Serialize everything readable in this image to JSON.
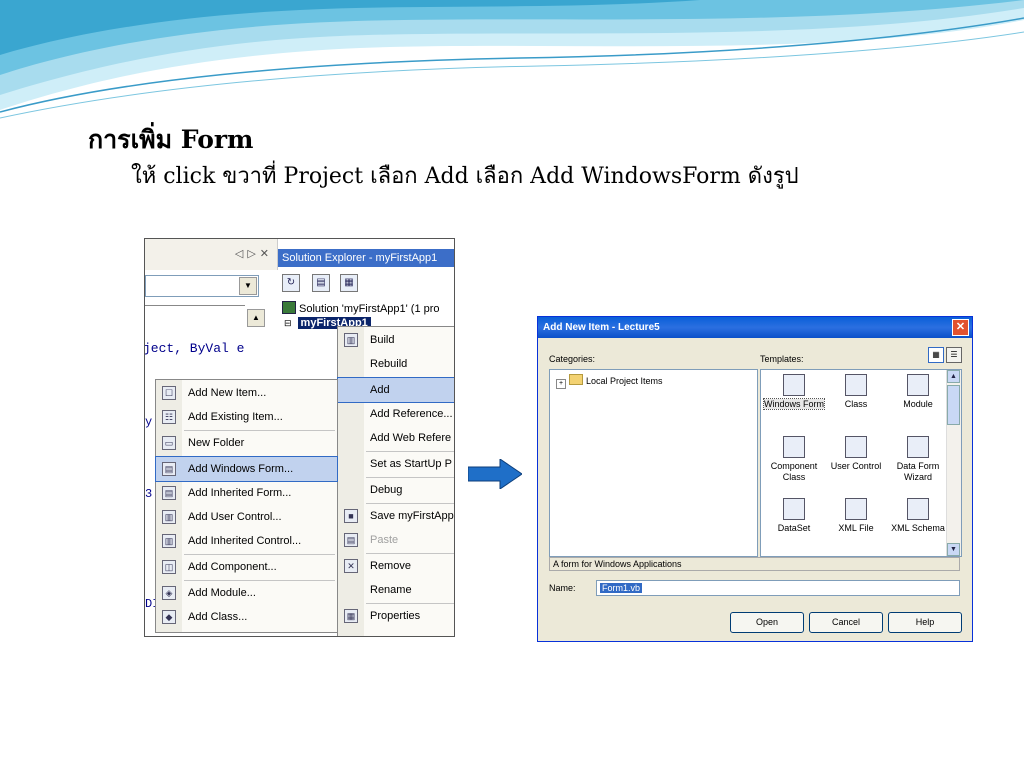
{
  "slide": {
    "title": "การเพิ่ม Form",
    "subtitle": "ให้ click ขวาที่ Project เลือก Add เลือก Add WindowsForm ดังรูป"
  },
  "editor": {
    "code_line": "ject, ByVal e",
    "fragments": [
      "y'",
      "3'",
      "DI"
    ]
  },
  "solution_explorer": {
    "title": "Solution Explorer - myFirstApp1",
    "solution_item": "Solution 'myFirstApp1' (1 pro",
    "project_item": "myFirstApp1"
  },
  "project_menu": {
    "items": [
      {
        "label": "Build",
        "icon": "build-icon"
      },
      {
        "label": "Rebuild",
        "icon": ""
      },
      {
        "label": "Add",
        "icon": "",
        "highlighted": true
      },
      {
        "label": "Add Reference...",
        "icon": ""
      },
      {
        "label": "Add Web Refere",
        "icon": ""
      },
      {
        "label": "Set as StartUp P",
        "icon": ""
      },
      {
        "label": "Debug",
        "icon": ""
      },
      {
        "label": "Save myFirstApp",
        "icon": "save-icon"
      },
      {
        "label": "Paste",
        "icon": "paste-icon",
        "disabled": true
      },
      {
        "label": "Remove",
        "icon": "remove-icon"
      },
      {
        "label": "Rename",
        "icon": ""
      },
      {
        "label": "Properties",
        "icon": "properties-icon"
      }
    ]
  },
  "add_submenu": {
    "items": [
      {
        "label": "Add New Item...",
        "icon": "new-item-icon"
      },
      {
        "label": "Add Existing Item...",
        "icon": "existing-item-icon"
      },
      {
        "label": "New Folder",
        "icon": "folder-icon"
      },
      {
        "label": "Add Windows Form...",
        "icon": "windows-form-icon",
        "highlighted": true
      },
      {
        "label": "Add Inherited Form...",
        "icon": "inherited-form-icon"
      },
      {
        "label": "Add User Control...",
        "icon": "user-control-icon"
      },
      {
        "label": "Add Inherited Control...",
        "icon": "inherited-control-icon"
      },
      {
        "label": "Add Component...",
        "icon": "component-icon"
      },
      {
        "label": "Add Module...",
        "icon": "module-icon"
      },
      {
        "label": "Add Class...",
        "icon": "class-icon"
      }
    ]
  },
  "dialog": {
    "title": "Add New Item - Lecture5",
    "categories_label": "Categories:",
    "templates_label": "Templates:",
    "category_item": "Local Project Items",
    "templates": [
      {
        "label": "Windows Form",
        "selected": true
      },
      {
        "label": "Class"
      },
      {
        "label": "Module"
      },
      {
        "label": "Component Class"
      },
      {
        "label": "User Control"
      },
      {
        "label": "Data Form Wizard"
      },
      {
        "label": "DataSet"
      },
      {
        "label": "XML File"
      },
      {
        "label": "XML Schema"
      }
    ],
    "description": "A form for Windows Applications",
    "name_label": "Name:",
    "name_value": "Form1.vb",
    "buttons": {
      "open": "Open",
      "cancel": "Cancel",
      "help": "Help"
    }
  },
  "colors": {
    "wave_light": "#a8dcee",
    "wave_dark": "#3aa6d0",
    "xp_title": "#0a5fd8",
    "highlight": "#c1d2ee",
    "arrow": "#1f6fc8"
  }
}
